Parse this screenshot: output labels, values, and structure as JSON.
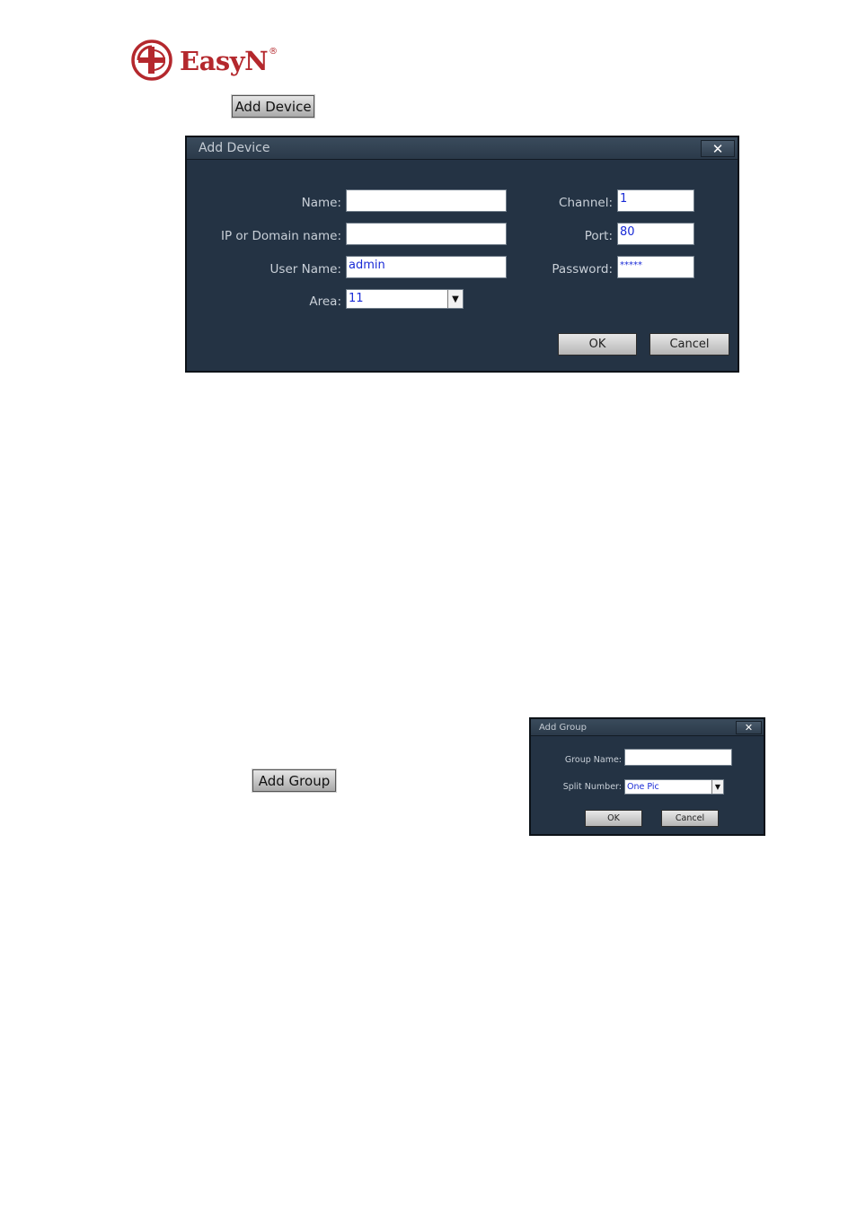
{
  "brand": {
    "name": "EasyN",
    "registered": "®"
  },
  "add_device_button": {
    "label": "Add Device"
  },
  "add_device_dialog": {
    "title": "Add Device",
    "close": "✕",
    "name_label": "Name:",
    "name_value": "",
    "ip_label": "IP or Domain name:",
    "ip_value": "",
    "user_label": "User Name:",
    "user_value": "admin",
    "area_label": "Area:",
    "area_value": "11",
    "channel_label": "Channel:",
    "channel_value": "1",
    "port_label": "Port:",
    "port_value": "80",
    "password_label": "Password:",
    "password_value": "*****",
    "ok": "OK",
    "cancel": "Cancel"
  },
  "add_group_button": {
    "label": "Add Group"
  },
  "add_group_dialog": {
    "title": "Add Group",
    "close": "✕",
    "group_name_label": "Group Name:",
    "group_name_value": "",
    "split_label": "Split Number:",
    "split_value": "One Pic",
    "ok": "OK",
    "cancel": "Cancel"
  },
  "colors": {
    "dialog_bg": "#243344",
    "brand": "#b4282d",
    "field_text": "#1a2bd6"
  },
  "icons": {
    "logo": "globe-logo-icon",
    "dropdown": "chevron-down-icon",
    "close": "close-icon"
  }
}
